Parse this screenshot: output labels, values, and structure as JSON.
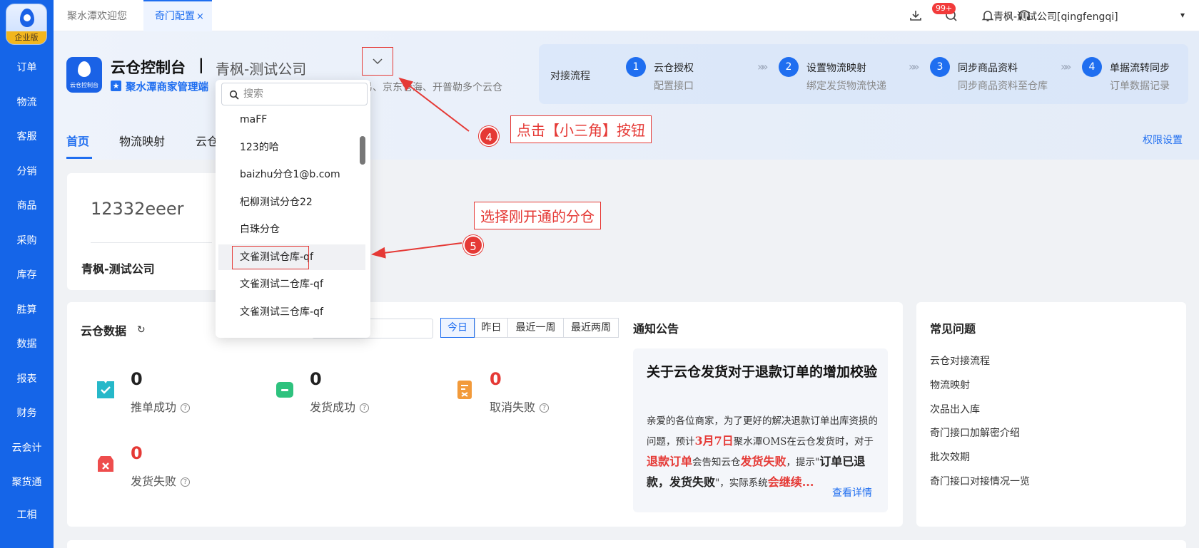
{
  "sidebar": {
    "logo_badge": "企业版",
    "items": [
      "订单",
      "物流",
      "客服",
      "分销",
      "商品",
      "采购",
      "库存",
      "胜算",
      "数据",
      "报表",
      "财务",
      "云会计",
      "聚货通",
      "工相"
    ]
  },
  "tabs": {
    "welcome": "聚水潭欢迎您",
    "active": "奇门配置",
    "close": "×"
  },
  "topbar": {
    "notification_badge": "99+",
    "user": "青枫-测试公司[qingfengqi]",
    "user_caret": "▾"
  },
  "header": {
    "app_icon_caption": "云仓控制台",
    "title": "云仓控制台",
    "separator": "|",
    "company": "青枫-测试公司",
    "sub_prefix": "聚水潭商家管理端",
    "desc": "易、京东仓海、开普勒多个云仓"
  },
  "flow": {
    "label": "对接流程",
    "steps": [
      {
        "num": "1",
        "title": "云仓授权",
        "desc": "配置接口"
      },
      {
        "num": "2",
        "title": "设置物流映射",
        "desc": "绑定发货物流快递"
      },
      {
        "num": "3",
        "title": "同步商品资料",
        "desc": "同步商品资料至仓库"
      },
      {
        "num": "4",
        "title": "单据流转同步",
        "desc": "订单数据记录"
      }
    ],
    "chevron": "»»"
  },
  "subnav": {
    "items": [
      "首页",
      "物流映射",
      "云仓"
    ],
    "permissions": "权限设置"
  },
  "account": {
    "id": "12332eeer",
    "company": "青枫-测试公司"
  },
  "cloud_data": {
    "title": "云仓数据",
    "refresh": "↻",
    "ranges": [
      "今日",
      "昨日",
      "最近一周",
      "最近两周"
    ],
    "stats": [
      {
        "value": "0",
        "label": "推单成功",
        "color": "#26b8c9"
      },
      {
        "value": "0",
        "label": "发货成功",
        "color": "#2ec27e"
      },
      {
        "value": "0",
        "label": "取消失败",
        "color": "#f29a3a"
      },
      {
        "value": "0",
        "label": "发货失败",
        "color": "#ee4d4d"
      }
    ],
    "help": "?"
  },
  "notice": {
    "title": "通知公告",
    "headline": "关于云仓发货对于退款订单的增加校验",
    "body": {
      "p1": "亲爱的各位商家，为了更好的解决退款订单出库资损的问题，预计",
      "date": "3月7日",
      "p2": "聚水潭OMS在云仓发货时，对于",
      "refund": "退款订单",
      "p3": "会告知云仓",
      "fail": "发货失败",
      "p4": "，提示\"",
      "quote": "订单已退款，发货失败",
      "p5": "\"，实际系统",
      "cont": "会继续..."
    },
    "more": "查看详情"
  },
  "faq": {
    "title": "常见问题",
    "items": [
      "云仓对接流程",
      "物流映射",
      "次品出入库",
      "奇门接口加解密介绍",
      "批次效期",
      "奇门接口对接情况一览"
    ]
  },
  "dropdown": {
    "search_placeholder": "搜索",
    "options": [
      "maFF",
      "123的哈",
      "baizhu分仓1@b.com",
      "杞柳测试分仓22",
      "白珠分仓",
      "文雀测试仓库-qf",
      "文雀测试二仓库-qf",
      "文雀测试三仓库-qf"
    ],
    "highlighted": "文雀测试仓库-qf"
  },
  "annotations": {
    "step4_num": "4",
    "step4_text": "点击【小三角】按钮",
    "step5_num": "5",
    "step5_text": "选择刚开通的分仓",
    "color": "#e53935"
  },
  "colors": {
    "primary": "#1f6ef0",
    "sidebar": "#1565e8",
    "danger": "#e53935"
  }
}
